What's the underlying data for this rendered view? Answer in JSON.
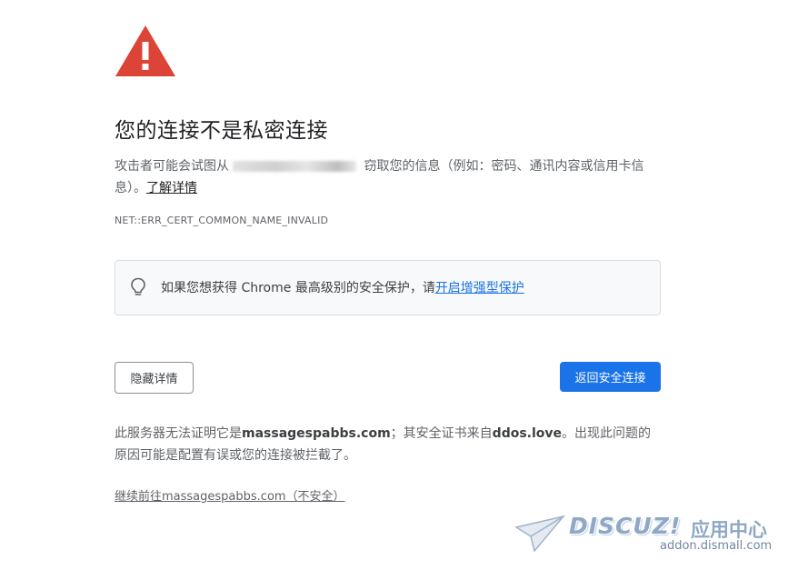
{
  "page": {
    "title": "您的连接不是私密连接",
    "description": {
      "before_host": "攻击者可能会试图从",
      "after_host": " 窃取您的信息（例如：密码、通讯内容或信用卡信息）。",
      "learn_more": "了解详情"
    },
    "error_code": "NET::ERR_CERT_COMMON_NAME_INVALID"
  },
  "promo": {
    "text": "如果您想获得 Chrome 最高级别的安全保护，请",
    "link": "开启增强型保护"
  },
  "buttons": {
    "details": "隐藏详情",
    "back": "返回安全连接"
  },
  "details": {
    "part1": "此服务器无法证明它是",
    "domain": "massagespabbs.com",
    "part2": "；其安全证书来自",
    "issuer": "ddos.love",
    "part3": "。出现此问题的原因可能是配置有误或您的连接被拦截了。"
  },
  "proceed_link": "继续前往massagespabbs.com（不安全）",
  "watermark": {
    "brand": "DISCUZ!",
    "cn": "应用中心",
    "url": "addon.dismall.com"
  },
  "colors": {
    "warning_red": "#db4437",
    "primary_blue": "#1a73e8"
  }
}
